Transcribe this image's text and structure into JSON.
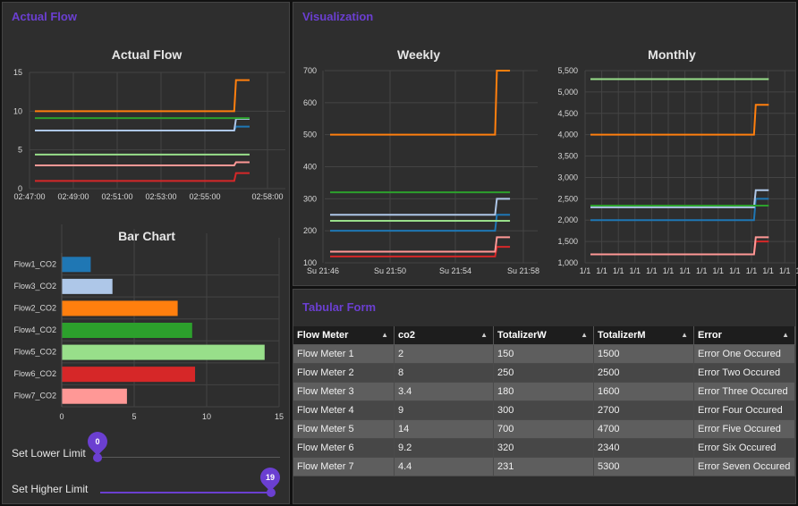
{
  "panels": {
    "actual_flow": "Actual Flow",
    "visualization": "Visualization",
    "tabular": "Tabular Form"
  },
  "colors": {
    "accent": "#6b3fd1",
    "series": [
      "#1f77b4",
      "#aec7e8",
      "#ff7f0e",
      "#2ca02c",
      "#98df8a",
      "#d62728",
      "#ff9896"
    ]
  },
  "sliders": {
    "lower": {
      "label": "Set Lower Limit",
      "value": "0",
      "min": 0,
      "max": 19,
      "fraction": 0
    },
    "higher": {
      "label": "Set Higher Limit",
      "value": "19",
      "min": 0,
      "max": 19,
      "fraction": 1
    }
  },
  "table": {
    "headers": [
      "Flow Meter",
      "co2",
      "TotalizerW",
      "TotalizerM",
      "Error"
    ],
    "rows": [
      [
        "Flow Meter 1",
        "2",
        "150",
        "1500",
        "Error One Occured"
      ],
      [
        "Flow Meter 2",
        "8",
        "250",
        "2500",
        "Error Two Occured"
      ],
      [
        "Flow Meter 3",
        "3.4",
        "180",
        "1600",
        "Error Three Occured"
      ],
      [
        "Flow Meter 4",
        "9",
        "300",
        "2700",
        "Error Four Occured"
      ],
      [
        "Flow Meter 5",
        "14",
        "700",
        "4700",
        "Error Five Occured"
      ],
      [
        "Flow Meter 6",
        "9.2",
        "320",
        "2340",
        "Error Six Occured"
      ],
      [
        "Flow Meter 7",
        "4.4",
        "231",
        "5300",
        "Error Seven Occured"
      ]
    ]
  },
  "chart_data": [
    {
      "type": "line",
      "title": "Actual Flow",
      "xlabel": "",
      "ylabel": "",
      "x_ticks": [
        "02:47:00",
        "02:49:00",
        "02:51:00",
        "02:53:00",
        "02:55:00",
        "02:58:00"
      ],
      "y_ticks": [
        "0",
        "5",
        "10",
        "15"
      ],
      "ylim": [
        0,
        15
      ],
      "grid": true,
      "series": [
        {
          "values_before": 7.5,
          "values_after": 8.0
        },
        {
          "values_before": 7.5,
          "values_after": 9.0
        },
        {
          "values_before": 10.0,
          "values_after": 14.0
        },
        {
          "values_before": 9.1,
          "values_after": 9.1
        },
        {
          "values_before": 4.4,
          "values_after": 4.4
        },
        {
          "values_before": 1.0,
          "values_after": 2.0
        },
        {
          "values_before": 3.0,
          "values_after": 3.4
        }
      ]
    },
    {
      "type": "bar",
      "title": "Bar Chart",
      "categories": [
        "Flow1_CO2",
        "Flow3_CO2",
        "Flow2_CO2",
        "Flow4_CO2",
        "Flow5_CO2",
        "Flow6_CO2",
        "Flow7_CO2"
      ],
      "values": [
        2,
        3.5,
        8,
        9,
        14,
        9.2,
        4.5
      ],
      "x_ticks": [
        "0",
        "5",
        "10",
        "15"
      ],
      "xlim": [
        0,
        15
      ],
      "orientation": "horizontal",
      "grid": true
    },
    {
      "type": "line",
      "title": "Weekly",
      "x_ticks": [
        "Su 21:46",
        "Su 21:50",
        "Su 21:54",
        "Su 21:58"
      ],
      "y_ticks": [
        "100",
        "200",
        "300",
        "400",
        "500",
        "600",
        "700"
      ],
      "ylim": [
        100,
        700
      ],
      "grid": true,
      "series": [
        {
          "values_before": 200,
          "values_after": 250
        },
        {
          "values_before": 250,
          "values_after": 300
        },
        {
          "values_before": 500,
          "values_after": 700
        },
        {
          "values_before": 320,
          "values_after": 320
        },
        {
          "values_before": 231,
          "values_after": 231
        },
        {
          "values_before": 120,
          "values_after": 150
        },
        {
          "values_before": 135,
          "values_after": 180
        }
      ]
    },
    {
      "type": "line",
      "title": "Monthly",
      "x_ticks": [
        "1/1",
        "1/1",
        "1/1",
        "1/1",
        "1/1",
        "1/1",
        "1/1",
        "1/1",
        "1/1",
        "1/1",
        "1/1",
        "1/1",
        "1/1",
        "1/1"
      ],
      "y_ticks": [
        "1,000",
        "1,500",
        "2,000",
        "2,500",
        "3,000",
        "3,500",
        "4,000",
        "4,500",
        "5,000",
        "5,500"
      ],
      "ylim": [
        1000,
        5500
      ],
      "grid": true,
      "series": [
        {
          "values_before": 2000,
          "values_after": 2500
        },
        {
          "values_before": 2300,
          "values_after": 2700
        },
        {
          "values_before": 4000,
          "values_after": 4700
        },
        {
          "values_before": 2340,
          "values_after": 2340
        },
        {
          "values_before": 5300,
          "values_after": 5300
        },
        {
          "values_before": 1200,
          "values_after": 1500
        },
        {
          "values_before": 1200,
          "values_after": 1600
        }
      ]
    }
  ]
}
